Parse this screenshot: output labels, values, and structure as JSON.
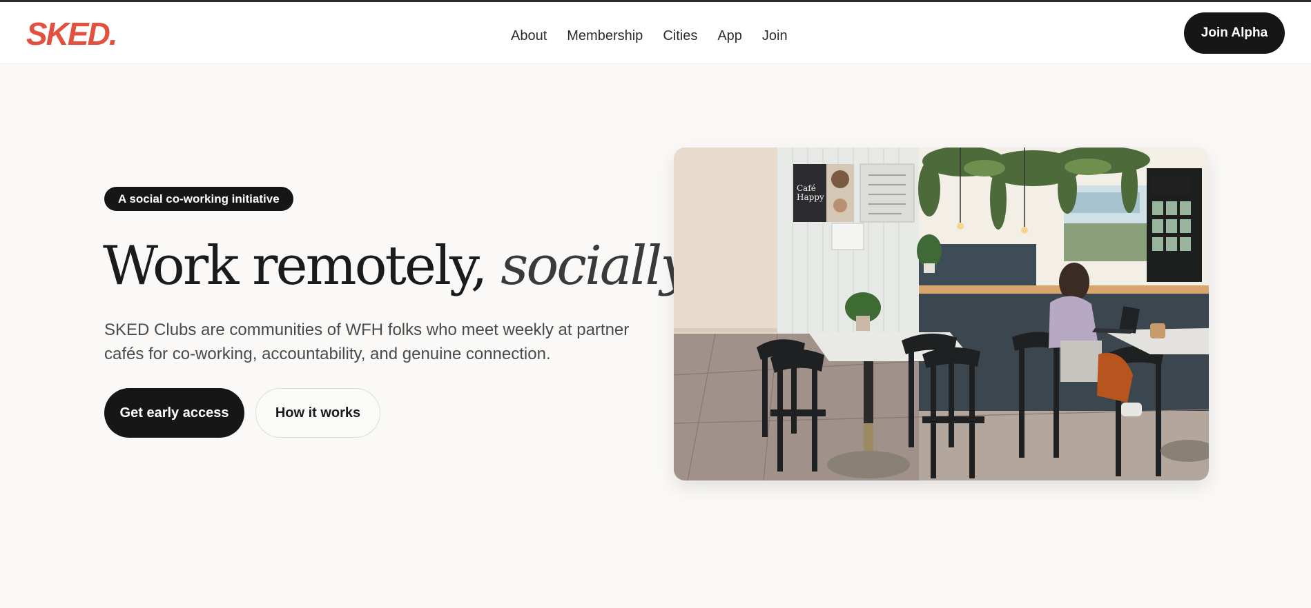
{
  "brand": {
    "logo_text": "SKED.",
    "color": "#e2513f"
  },
  "nav": {
    "items": [
      {
        "label": "About"
      },
      {
        "label": "Membership"
      },
      {
        "label": "Cities"
      },
      {
        "label": "App"
      },
      {
        "label": "Join"
      }
    ],
    "cta_label": "Join Alpha"
  },
  "hero": {
    "badge": "A social co-working initiative",
    "headline_main": "Work remotely, ",
    "headline_emphasis": "socially",
    "headline_end": ".",
    "subtitle": "SKED Clubs are communities of WFH folks who meet weekly at partner cafés for co-working, accountability, and genuine connection.",
    "primary_cta": "Get early access",
    "secondary_cta": "How it works",
    "image_subject": "cafe-interior-photo",
    "image_sign_text": [
      "Café",
      "Happy"
    ]
  },
  "colors": {
    "dark": "#161616",
    "background": "#faf9f7",
    "accent": "#e2513f"
  }
}
